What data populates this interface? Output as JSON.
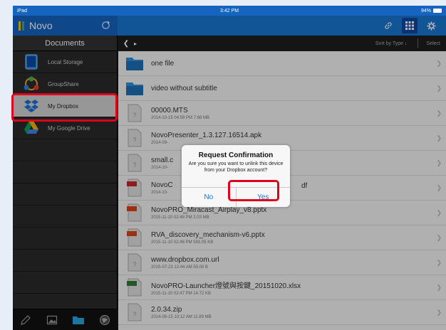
{
  "status_bar": {
    "left": "iPad",
    "time": "3:42 PM",
    "battery": "94%"
  },
  "app": {
    "title": "Novo"
  },
  "sidebar": {
    "header": "Documents",
    "items": [
      {
        "label": "Local Storage",
        "icon": "tablet-icon"
      },
      {
        "label": "GroupShare",
        "icon": "groupshare-icon"
      },
      {
        "label": "My Dropbox",
        "icon": "dropbox-icon"
      },
      {
        "label": "My Google Drive",
        "icon": "google-drive-icon"
      }
    ]
  },
  "toolbar": {
    "sort_label": "Sort by Type ↓",
    "select_label": "Select"
  },
  "files": [
    {
      "name": "one file",
      "meta": "",
      "type": "folder"
    },
    {
      "name": "video without subtitle",
      "meta": "",
      "type": "folder"
    },
    {
      "name": "00000.MTS",
      "meta": "2014-10-15 04:59 PM  7.68 MB",
      "type": "unknown"
    },
    {
      "name": "NovoPresenter_1.3.127.16514.apk",
      "meta": "2014-09-",
      "type": "unknown"
    },
    {
      "name": "small.c",
      "meta": "2014-10-",
      "type": "unknown"
    },
    {
      "name": "NovoC",
      "name_end": "df",
      "meta": "2014-10-",
      "type": "pdf"
    },
    {
      "name": "NovoPRO_Miracast_Airplay_v8.pptx",
      "meta": "2015-11-10 02:48 PM  2.03 MB",
      "type": "ppt"
    },
    {
      "name": "RVA_discovery_mechanism-v6.pptx",
      "meta": "2015-11-10 02:46 PM  593.05 KB",
      "type": "ppt"
    },
    {
      "name": "www.dropbox.com.url",
      "meta": "2015-07-23 12:44 AM  55.00 B",
      "type": "unknown"
    },
    {
      "name": "NovoPRO-Launcher燈號與按鍵_20151020.xlsx",
      "meta": "2015-11-10 02:47 PM  14.72 KB",
      "type": "xls"
    },
    {
      "name": "2.0.34.zip",
      "meta": "2014-08-15 10:12 AM  11.89 MB",
      "type": "unknown"
    }
  ],
  "dialog": {
    "title": "Request Confirmation",
    "message": "Are you sure you want to unlink this device from your Dropbox account?",
    "no_label": "No",
    "yes_label": "Yes"
  },
  "badges": {
    "pdf": "PDF",
    "ppt": "PPT",
    "xls": "XLS"
  },
  "colors": {
    "accent": "#1976d2",
    "highlight": "#e0001b",
    "link": "#1a73e8"
  }
}
